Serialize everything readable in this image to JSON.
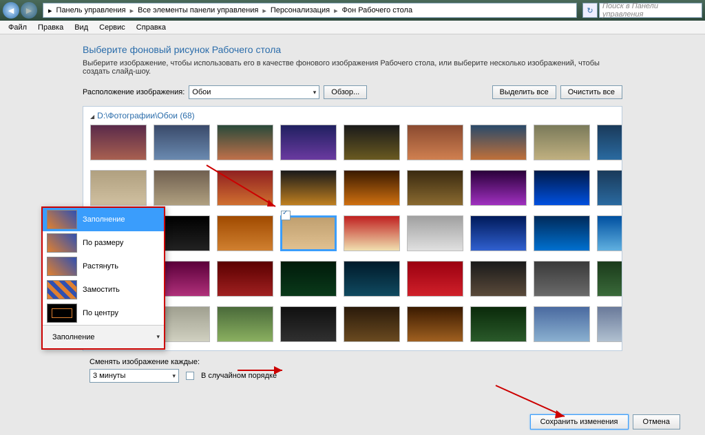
{
  "breadcrumb": {
    "p1": "Панель управления",
    "p2": "Все элементы панели управления",
    "p3": "Персонализация",
    "p4": "Фон Рабочего стола"
  },
  "search": {
    "placeholder": "Поиск в Панели управления"
  },
  "menu": {
    "file": "Файл",
    "edit": "Правка",
    "view": "Вид",
    "service": "Сервис",
    "help": "Справка"
  },
  "heading": "Выберите фоновый рисунок Рабочего стола",
  "sub": "Выберите изображение, чтобы использовать его в качестве фонового изображения Рабочего стола, или выберите несколько изображений, чтобы создать слайд-шоу.",
  "loc_label": "Расположение изображения:",
  "loc_value": "Обои",
  "browse": "Обзор...",
  "select_all": "Выделить все",
  "clear_all": "Очистить все",
  "folder": "D:\\Фотографии\\Обои (68)",
  "thumbs": [
    "linear-gradient(#5a2a4a,#a86050)",
    "linear-gradient(#3a4a6a,#6a8ab0)",
    "linear-gradient(#2a4a3a,#c0704a)",
    "linear-gradient(#202060,#6a3aa0)",
    "linear-gradient(#1a1a1a,#6a5a20)",
    "linear-gradient(#8a4a30,#d08050)",
    "linear-gradient(#2a4a6a,#c0703a)",
    "linear-gradient(#7a7a5a,#c0b080)",
    "linear-gradient(#1a3a5a,#2a6aa0)",
    "linear-gradient(#b0a080,#d0c0a0)",
    "linear-gradient(#706050,#b0a080)",
    "linear-gradient(#902020,#d07030)",
    "linear-gradient(#1a1a1a,#c08020)",
    "linear-gradient(#3a1a00,#d07010)",
    "linear-gradient(#3a2a10,#8a6a30)",
    "linear-gradient(#2a003a,#a030c0)",
    "linear-gradient(#001a4a,#0050e0)",
    "linear-gradient(#1a3a5a,#2a6aa0)",
    "linear-gradient(#5a4a3a,#8a7a60)",
    "linear-gradient(#000,#222)",
    "linear-gradient(#a04a00,#d08030)",
    "linear-gradient(#c0a070,#e0c090)",
    "linear-gradient(#c02020,#f0e0b0)",
    "linear-gradient(#a0a0a0,#e0e0e0)",
    "linear-gradient(#001a5a,#3060d0)",
    "linear-gradient(#002a5a,#0070d0)",
    "linear-gradient(#0050a0,#60b0e0)",
    "linear-gradient(#c02030,#e05060)",
    "linear-gradient(#5a003a,#b0307a)",
    "linear-gradient(#5a0000,#a02020)",
    "linear-gradient(#001a0a,#0a3a1a)",
    "linear-gradient(#001a2a,#104a60)",
    "linear-gradient(#9a0010,#d0202a)",
    "linear-gradient(#1a1a1a,#5a4a3a)",
    "linear-gradient(#3a3a3a,#6a6a6a)",
    "linear-gradient(#1a3a1a,#3a6a3a)",
    "linear-gradient(#2a2a2a,#5a5a5a)",
    "linear-gradient(#a0a090,#d0d0c0)",
    "linear-gradient(#4a6a3a,#8ab060)",
    "linear-gradient(#101010,#303030)",
    "linear-gradient(#2a1a0a,#6a4a20)",
    "linear-gradient(#3a1a00,#a06020)",
    "linear-gradient(#0a2a0a,#2a5a2a)",
    "linear-gradient(#4a6aa0,#8ab0d0)",
    "linear-gradient(#6a7a9a,#b0c0d0)"
  ],
  "popup": {
    "o1": "Заполнение",
    "o2": "По размеру",
    "o3": "Растянуть",
    "o4": "Замостить",
    "o5": "По центру",
    "footer": "Заполнение"
  },
  "change_label": "Сменять изображение каждые:",
  "interval": "3 минуты",
  "shuffle": "В случайном порядке",
  "save": "Сохранить изменения",
  "cancel": "Отмена"
}
